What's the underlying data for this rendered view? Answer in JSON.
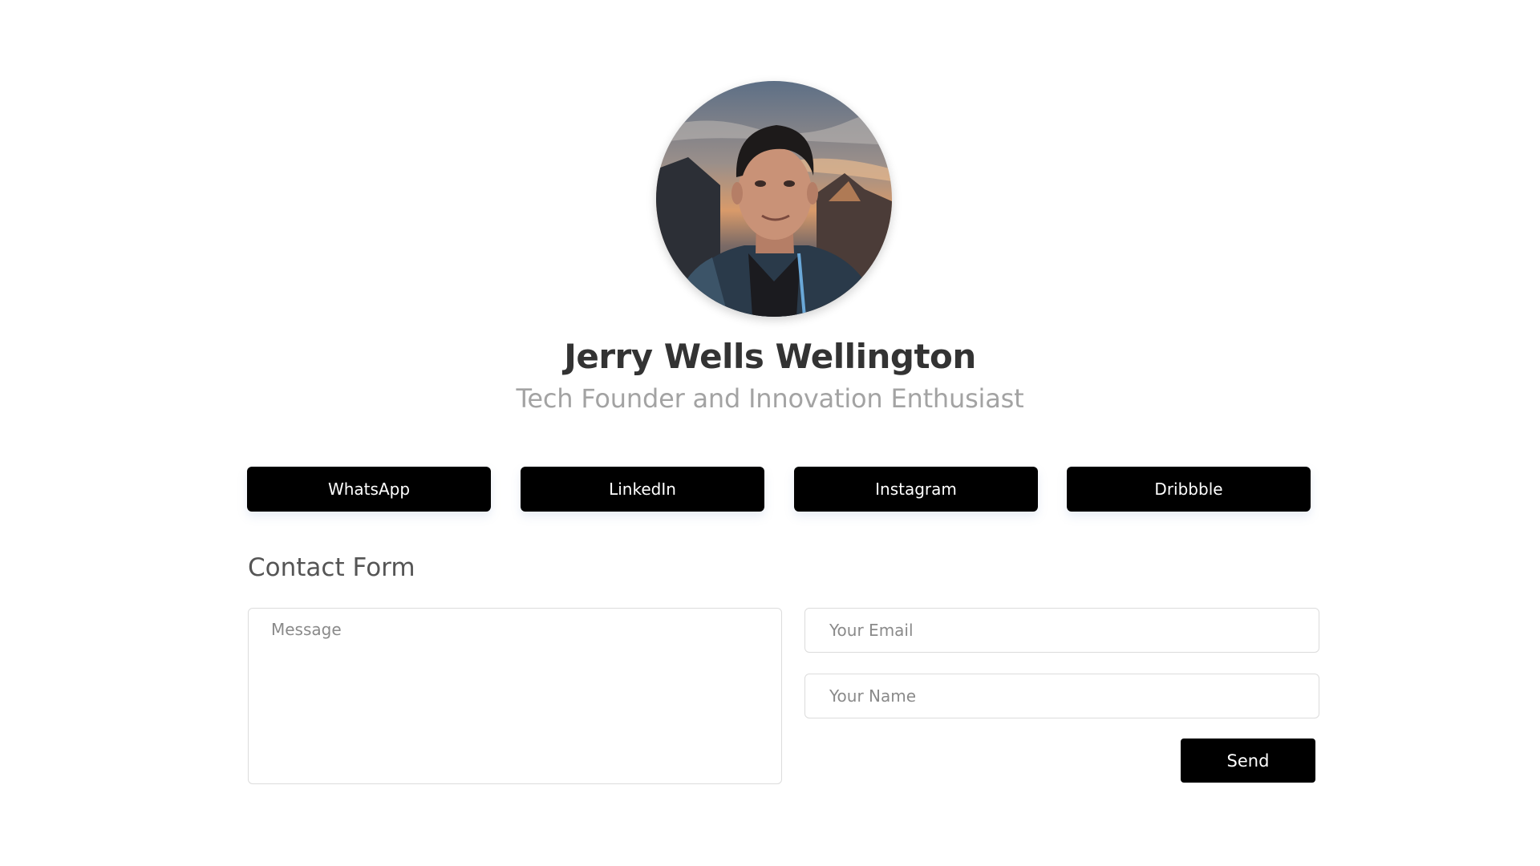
{
  "profile": {
    "name": "Jerry Wells Wellington",
    "title": "Tech Founder and Innovation Enthusiast",
    "avatar_icon": "profile-photo"
  },
  "social": {
    "buttons": [
      {
        "label": "WhatsApp"
      },
      {
        "label": "LinkedIn"
      },
      {
        "label": "Instagram"
      },
      {
        "label": "Dribbble"
      }
    ]
  },
  "contact": {
    "heading": "Contact Form",
    "message_placeholder": "Message",
    "email_placeholder": "Your Email",
    "name_placeholder": "Your Name",
    "send_label": "Send"
  },
  "colors": {
    "button_bg": "#000000",
    "button_text": "#ffffff",
    "name_color": "#333333",
    "title_color": "#a3a3a3",
    "border": "#dcdcdc"
  }
}
